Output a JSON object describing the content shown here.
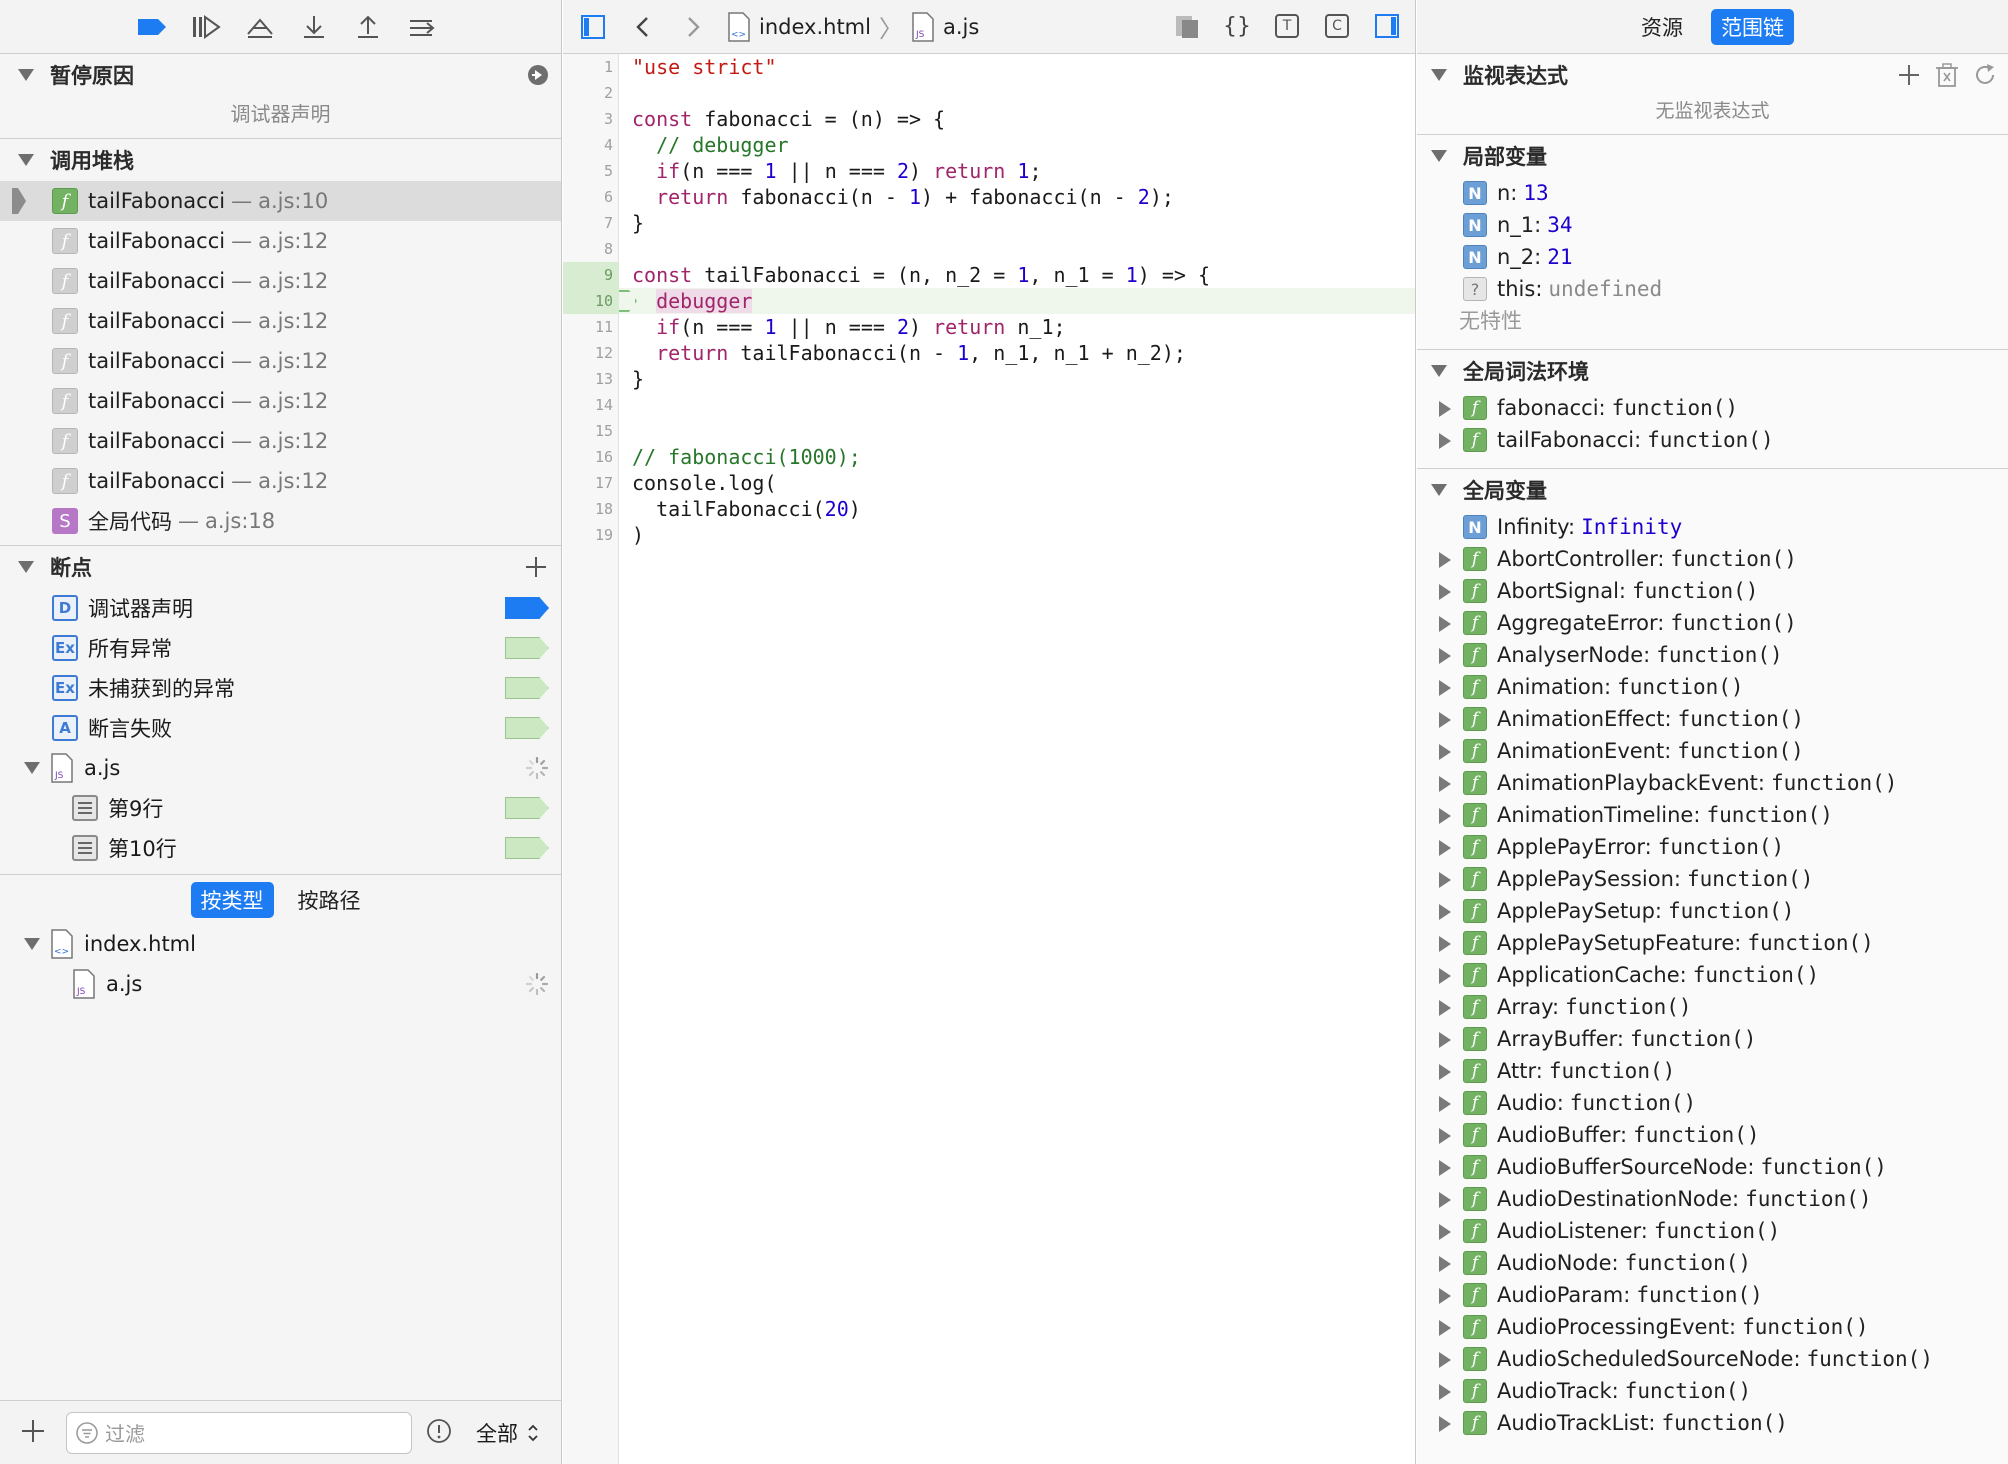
{
  "debug_toolbar": {
    "buttons": [
      "pause-breakpoints",
      "continue",
      "step-over",
      "step-into",
      "step-out",
      "step-next"
    ]
  },
  "pause_reason": {
    "title": "暂停原因",
    "reason": "调试器声明"
  },
  "call_stack": {
    "title": "调用堆栈",
    "frames": [
      {
        "name": "tailFabonacci",
        "sep": "—",
        "loc": "a.js:10"
      },
      {
        "name": "tailFabonacci",
        "sep": "—",
        "loc": "a.js:12"
      },
      {
        "name": "tailFabonacci",
        "sep": "—",
        "loc": "a.js:12"
      },
      {
        "name": "tailFabonacci",
        "sep": "—",
        "loc": "a.js:12"
      },
      {
        "name": "tailFabonacci",
        "sep": "—",
        "loc": "a.js:12"
      },
      {
        "name": "tailFabonacci",
        "sep": "—",
        "loc": "a.js:12"
      },
      {
        "name": "tailFabonacci",
        "sep": "—",
        "loc": "a.js:12"
      },
      {
        "name": "tailFabonacci",
        "sep": "—",
        "loc": "a.js:12"
      },
      {
        "name": "全局代码",
        "sep": "—",
        "loc": "a.js:18"
      }
    ]
  },
  "breakpoints": {
    "title": "断点",
    "items": [
      {
        "badge": "D",
        "label": "调试器声明"
      },
      {
        "badge": "Ex",
        "label": "所有异常"
      },
      {
        "badge": "Ex",
        "label": "未捕获到的异常"
      },
      {
        "badge": "A",
        "label": "断言失败"
      }
    ],
    "file": "a.js",
    "lines": [
      "第9行",
      "第10行"
    ]
  },
  "resources": {
    "seg_type": "按类型",
    "seg_path": "按路径",
    "root": "index.html",
    "child": "a.js"
  },
  "filter": {
    "placeholder": "过滤",
    "scope": "全部"
  },
  "breadcrumb": {
    "file1": "index.html",
    "file2": "a.js"
  },
  "editor": {
    "line_numbers": [
      "1",
      "2",
      "3",
      "4",
      "5",
      "6",
      "7",
      "8",
      "9",
      "10",
      "11",
      "12",
      "13",
      "14",
      "15",
      "16",
      "17",
      "18",
      "19"
    ]
  },
  "right_tabs": {
    "resources": "资源",
    "scope_chain": "范围链"
  },
  "watch": {
    "title": "监视表达式",
    "empty": "无监视表达式"
  },
  "locals": {
    "title": "局部变量",
    "vars": [
      {
        "name": "n:",
        "value": "13"
      },
      {
        "name": "n_1:",
        "value": "34"
      },
      {
        "name": "n_2:",
        "value": "21"
      }
    ],
    "this_name": "this:",
    "this_value": "undefined",
    "no_props": "无特性"
  },
  "global_lexical": {
    "title": "全局词法环境",
    "items": [
      {
        "name": "fabonacci:",
        "value": "function()"
      },
      {
        "name": "tailFabonacci:",
        "value": "function()"
      }
    ]
  },
  "global_vars": {
    "title": "全局变量",
    "infinity_name": "Infinity:",
    "infinity_value": "Infinity",
    "items": [
      {
        "name": "AbortController:",
        "value": "function()"
      },
      {
        "name": "AbortSignal:",
        "value": "function()"
      },
      {
        "name": "AggregateError:",
        "value": "function()"
      },
      {
        "name": "AnalyserNode:",
        "value": "function()"
      },
      {
        "name": "Animation:",
        "value": "function()"
      },
      {
        "name": "AnimationEffect:",
        "value": "function()"
      },
      {
        "name": "AnimationEvent:",
        "value": "function()"
      },
      {
        "name": "AnimationPlaybackEvent:",
        "value": "function()"
      },
      {
        "name": "AnimationTimeline:",
        "value": "function()"
      },
      {
        "name": "ApplePayError:",
        "value": "function()"
      },
      {
        "name": "ApplePaySession:",
        "value": "function()"
      },
      {
        "name": "ApplePaySetup:",
        "value": "function()"
      },
      {
        "name": "ApplePaySetupFeature:",
        "value": "function()"
      },
      {
        "name": "ApplicationCache:",
        "value": "function()"
      },
      {
        "name": "Array:",
        "value": "function()"
      },
      {
        "name": "ArrayBuffer:",
        "value": "function()"
      },
      {
        "name": "Attr:",
        "value": "function()"
      },
      {
        "name": "Audio:",
        "value": "function()"
      },
      {
        "name": "AudioBuffer:",
        "value": "function()"
      },
      {
        "name": "AudioBufferSourceNode:",
        "value": "function()"
      },
      {
        "name": "AudioDestinationNode:",
        "value": "function()"
      },
      {
        "name": "AudioListener:",
        "value": "function()"
      },
      {
        "name": "AudioNode:",
        "value": "function()"
      },
      {
        "name": "AudioParam:",
        "value": "function()"
      },
      {
        "name": "AudioProcessingEvent:",
        "value": "function()"
      },
      {
        "name": "AudioScheduledSourceNode:",
        "value": "function()"
      },
      {
        "name": "AudioTrack:",
        "value": "function()"
      },
      {
        "name": "AudioTrackList:",
        "value": "function()"
      }
    ]
  }
}
